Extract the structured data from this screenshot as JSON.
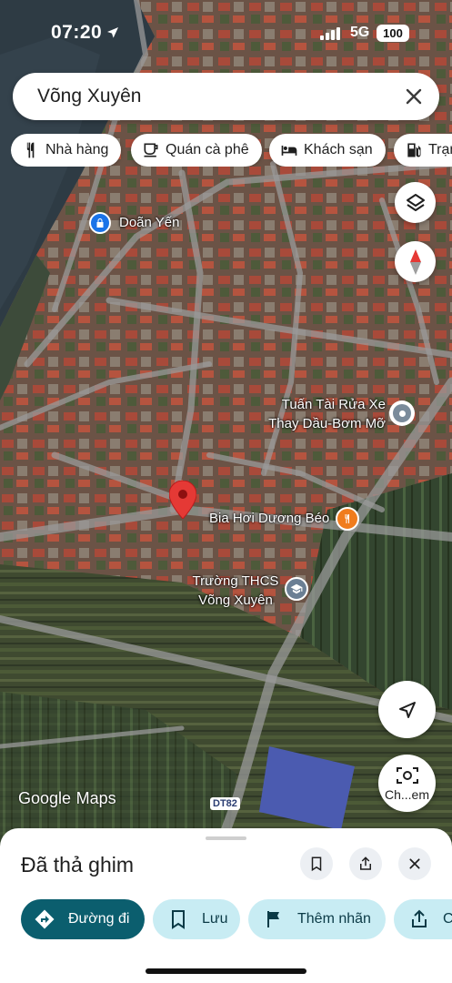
{
  "status_bar": {
    "time": "07:20",
    "network": "5G",
    "battery": "100"
  },
  "search": {
    "query": "Võng Xuyên"
  },
  "chips": [
    {
      "label": "Nhà hàng",
      "icon": "restaurant-icon"
    },
    {
      "label": "Quán cà phê",
      "icon": "coffee-icon"
    },
    {
      "label": "Khách sạn",
      "icon": "hotel-icon"
    },
    {
      "label": "Trạm",
      "icon": "gas-station-icon"
    }
  ],
  "map": {
    "labels": {
      "doan_yen": "Doãn Yến",
      "car_wash": "Tuấn Tài Rửa Xe\nThay Dầu-Bơm Mỡ",
      "beer": "Bia Hơi Dương Béo",
      "school": "Trường THCS\nVõng Xuyên"
    },
    "road_badge": "DT82",
    "logo": {
      "google": "Google",
      "maps": "Maps"
    },
    "camera_button_label": "Ch...em",
    "colors": {
      "poi_restaurant": "#f07c1d",
      "poi_school": "#6b7f94",
      "poi_service": "#7a8b9b",
      "poi_blue": "#1a73e8",
      "pin": "#e53935"
    }
  },
  "sheet": {
    "title": "Đã thả ghim",
    "actions": [
      {
        "label": "Đường đi",
        "icon": "directions-icon"
      },
      {
        "label": "Lưu",
        "icon": "bookmark-icon"
      },
      {
        "label": "Thêm nhãn",
        "icon": "flag-icon"
      },
      {
        "label": "Chia sẻ",
        "icon": "share-icon"
      }
    ]
  }
}
